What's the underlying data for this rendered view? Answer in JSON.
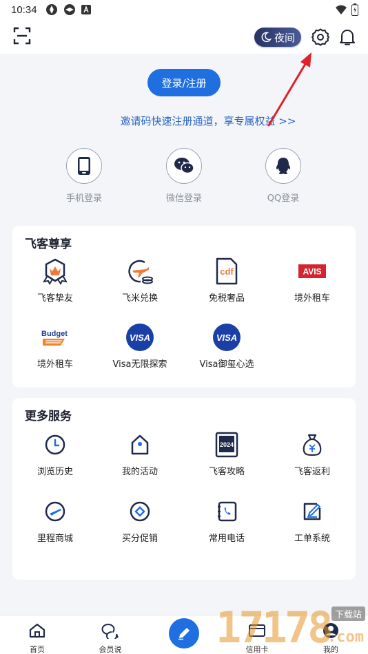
{
  "status_bar": {
    "time": "10:34"
  },
  "header": {
    "night_label": "夜间"
  },
  "login": {
    "button_label": "登录/注册",
    "invite_text": "邀请码快速注册通道，享专属权益 >>",
    "options": [
      {
        "label": "手机登录",
        "icon": "phone-icon"
      },
      {
        "label": "微信登录",
        "icon": "wechat-icon"
      },
      {
        "label": "QQ登录",
        "icon": "qq-icon"
      }
    ]
  },
  "privileges": {
    "title": "飞客尊享",
    "items": [
      {
        "label": "飞客挚友",
        "icon": "crown-badge-icon"
      },
      {
        "label": "飞米兑换",
        "icon": "plane-coin-icon"
      },
      {
        "label": "免税奢品",
        "icon": "cdf-icon",
        "icon_text": "cdf"
      },
      {
        "label": "境外租车",
        "icon": "avis-logo-icon",
        "icon_text": "AVIS"
      },
      {
        "label": "境外租车",
        "icon": "budget-logo-icon",
        "icon_text": "Budget"
      },
      {
        "label": "Visa无限探索",
        "icon": "visa-icon",
        "icon_text": "VISA"
      },
      {
        "label": "Visa御玺心选",
        "icon": "visa-icon",
        "icon_text": "VISA"
      }
    ]
  },
  "services": {
    "title": "更多服务",
    "items": [
      {
        "label": "浏览历史",
        "icon": "clock-icon"
      },
      {
        "label": "我的活动",
        "icon": "location-tag-icon"
      },
      {
        "label": "飞客攻略",
        "icon": "calendar-book-icon",
        "icon_text": "2024"
      },
      {
        "label": "飞客返利",
        "icon": "money-bag-icon"
      },
      {
        "label": "里程商城",
        "icon": "plane-circle-icon"
      },
      {
        "label": "买分促销",
        "icon": "diamond-circle-icon"
      },
      {
        "label": "常用电话",
        "icon": "phone-book-icon"
      },
      {
        "label": "工单系统",
        "icon": "edit-form-icon"
      }
    ]
  },
  "bottom_nav": {
    "items": [
      {
        "label": "首页",
        "icon": "home-icon"
      },
      {
        "label": "会员说",
        "icon": "chat-bubbles-icon"
      },
      {
        "label": "信用卡",
        "icon": "credit-card-icon"
      },
      {
        "label": "我的",
        "icon": "profile-icon"
      }
    ]
  },
  "watermark": {
    "big": "17178",
    "small": "下载站",
    "com": ".com"
  },
  "colors": {
    "primary": "#1f6fe0",
    "link": "#2d64c4",
    "night_bg": "#263363",
    "arrow": "#e0202a",
    "visa": "#1a3fa6"
  }
}
